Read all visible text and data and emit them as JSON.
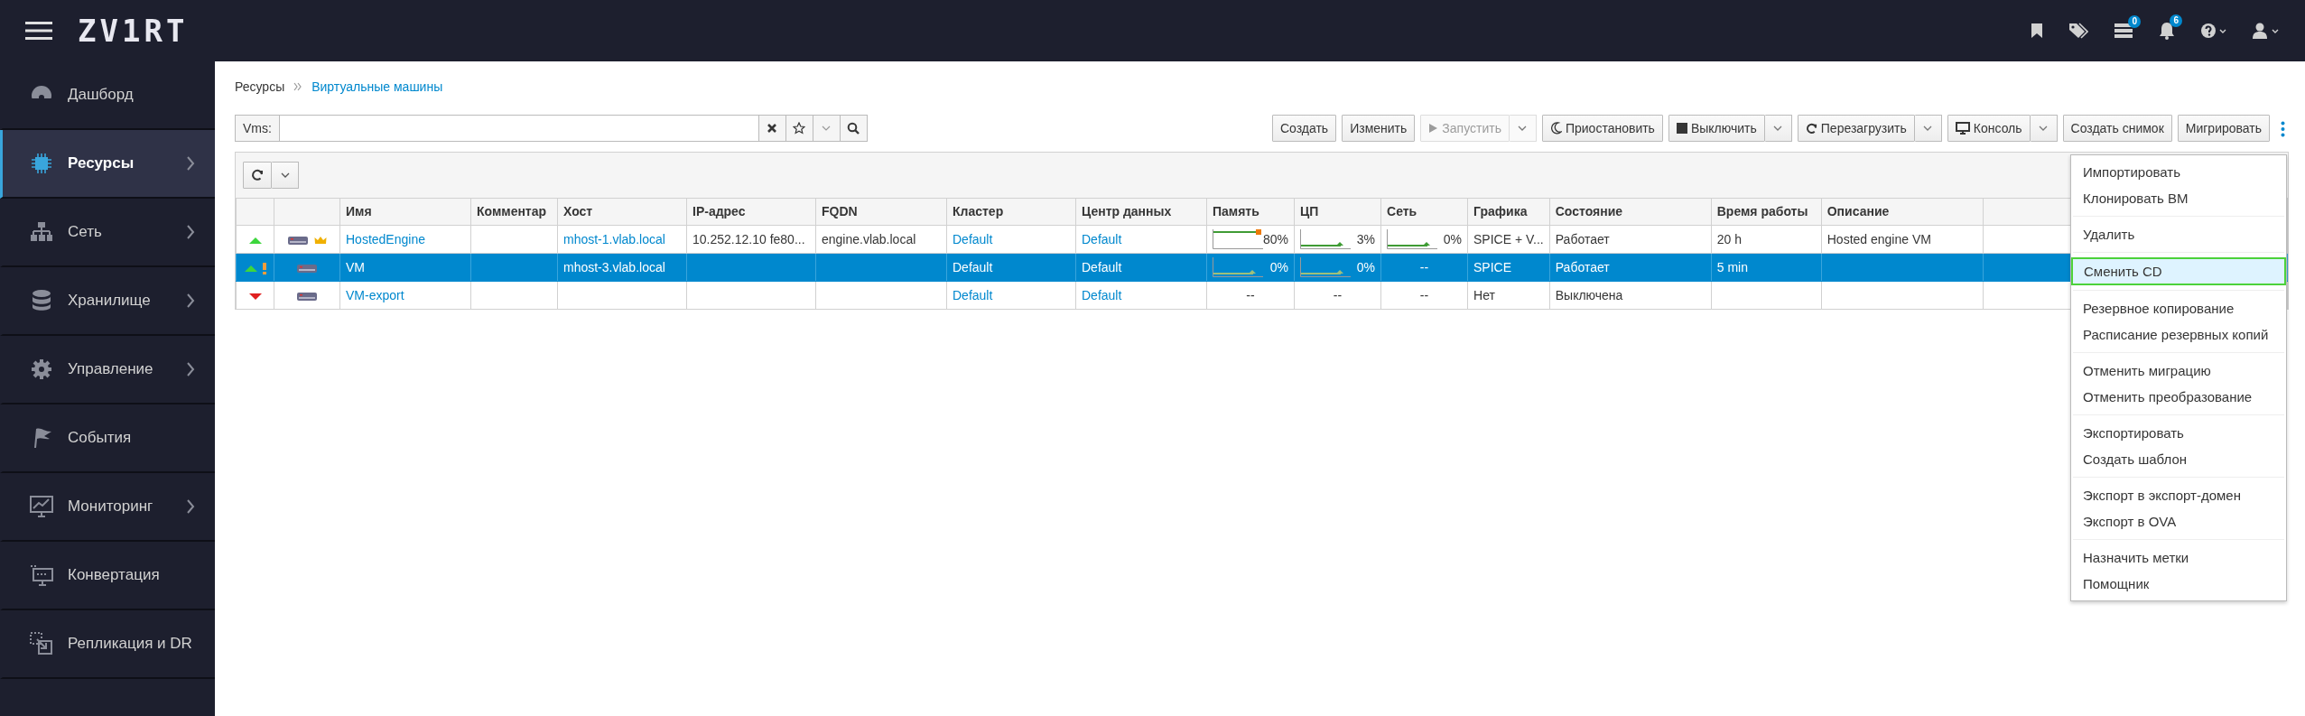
{
  "topbar": {
    "logo": "ZV1RT",
    "task_badge": "0",
    "alert_badge": "6"
  },
  "sidebar": {
    "items": [
      {
        "label": "Дашборд",
        "selected": false,
        "has_submenu": false
      },
      {
        "label": "Ресурсы",
        "selected": true,
        "has_submenu": true
      },
      {
        "label": "Сеть",
        "selected": false,
        "has_submenu": true
      },
      {
        "label": "Хранилище",
        "selected": false,
        "has_submenu": true
      },
      {
        "label": "Управление",
        "selected": false,
        "has_submenu": true
      },
      {
        "label": "События",
        "selected": false,
        "has_submenu": false
      },
      {
        "label": "Мониторинг",
        "selected": false,
        "has_submenu": true
      },
      {
        "label": "Конвертация",
        "selected": false,
        "has_submenu": false
      },
      {
        "label": "Репликация и DR",
        "selected": false,
        "has_submenu": false
      }
    ]
  },
  "breadcrumb": [
    {
      "label": "Ресурсы",
      "link": false
    },
    {
      "label": "Виртуальные машины",
      "link": true
    }
  ],
  "search": {
    "label": "Vms:"
  },
  "actions": [
    {
      "label": "Создать",
      "kind": "plain",
      "disabled": false
    },
    {
      "label": "Изменить",
      "kind": "plain",
      "disabled": false
    },
    {
      "label": "Запустить",
      "kind": "split",
      "disabled": true
    },
    {
      "label": "Приостановить",
      "kind": "plain",
      "disabled": false
    },
    {
      "label": "Выключить",
      "kind": "split",
      "disabled": false
    },
    {
      "label": "Перезагрузить",
      "kind": "split",
      "disabled": false
    },
    {
      "label": "Консоль",
      "kind": "split",
      "disabled": false
    },
    {
      "label": "Создать снимок",
      "kind": "plain",
      "disabled": false
    },
    {
      "label": "Мигрировать",
      "kind": "plain",
      "disabled": false
    }
  ],
  "table": {
    "columns": [
      {
        "kind": "status"
      },
      {
        "kind": "type"
      },
      {
        "label": "Имя",
        "kind": "text"
      },
      {
        "label": "Комментар",
        "kind": "text"
      },
      {
        "label": "Хост",
        "kind": "text"
      },
      {
        "label": "IP-адрес",
        "kind": "text"
      },
      {
        "label": "FQDN",
        "kind": "text"
      },
      {
        "label": "Кластер",
        "kind": "text"
      },
      {
        "label": "Центр данных",
        "kind": "text"
      },
      {
        "label": "Память",
        "kind": "usage"
      },
      {
        "label": "ЦП",
        "kind": "usage"
      },
      {
        "label": "Сеть",
        "kind": "usage"
      },
      {
        "label": "Графика",
        "kind": "text"
      },
      {
        "label": "Состояние",
        "kind": "text"
      },
      {
        "label": "Время работы",
        "kind": "text"
      },
      {
        "label": "Описание",
        "kind": "text"
      }
    ],
    "rows": [
      {
        "selected": false,
        "cells": [
          {
            "up": true,
            "alert": false
          },
          {
            "hosted_engine": true
          },
          {
            "text": "HostedEngine",
            "link": true
          },
          {},
          {
            "text": "mhost-1.vlab.local",
            "link": true
          },
          {
            "text": "10.252.12.10 fe80...",
            "link": false
          },
          {
            "text": "engine.vlab.local",
            "link": false
          },
          {
            "text": "Default",
            "link": true
          },
          {
            "text": "Default",
            "link": true
          },
          {
            "reading": "80%",
            "graph": true,
            "peak": true
          },
          {
            "reading": "3%",
            "graph": true,
            "peak": false
          },
          {
            "reading": "0%",
            "graph": true,
            "peak": false
          },
          {
            "text": "SPICE + V...",
            "link": false
          },
          {
            "text": "Работает",
            "link": false
          },
          {
            "text": "20 h",
            "link": false
          },
          {
            "text": "Hosted engine VM",
            "link": false
          }
        ]
      },
      {
        "selected": true,
        "cells": [
          {
            "up": true,
            "alert": true
          },
          {
            "hosted_engine": false
          },
          {
            "text": "VM"
          },
          {},
          {
            "text": "mhost-3.vlab.local"
          },
          {},
          {},
          {
            "text": "Default"
          },
          {
            "text": "Default"
          },
          {
            "reading": "0%",
            "graph": true,
            "peak": false
          },
          {
            "reading": "0%",
            "graph": true,
            "peak": false
          },
          {
            "reading": "--",
            "graph": false
          },
          {
            "text": "SPICE"
          },
          {
            "text": "Работает"
          },
          {
            "text": "5 min"
          },
          {}
        ]
      },
      {
        "selected": false,
        "cells": [
          {
            "up": false,
            "alert": false
          },
          {
            "hosted_engine": false
          },
          {
            "text": "VM-export",
            "link": true
          },
          {},
          {},
          {},
          {},
          {
            "text": "Default",
            "link": true
          },
          {
            "text": "Default",
            "link": true
          },
          {
            "reading": "--",
            "graph": false
          },
          {
            "reading": "--",
            "graph": false
          },
          {
            "reading": "--",
            "graph": false
          },
          {
            "text": "Нет",
            "link": false
          },
          {
            "text": "Выключена",
            "link": false
          },
          {},
          {}
        ]
      }
    ]
  },
  "menu": {
    "groups": [
      [
        {
          "label": "Импортировать",
          "selected": false
        },
        {
          "label": "Клонировать ВМ",
          "selected": false
        }
      ],
      [
        {
          "label": "Удалить",
          "selected": false
        }
      ],
      [
        {
          "label": "Сменить CD",
          "selected": true
        }
      ],
      [
        {
          "label": "Резервное копирование",
          "selected": false
        },
        {
          "label": "Расписание резервных копий",
          "selected": false
        }
      ],
      [
        {
          "label": "Отменить миграцию",
          "selected": false
        },
        {
          "label": "Отменить преобразование",
          "selected": false
        }
      ],
      [
        {
          "label": "Экспортировать",
          "selected": false
        },
        {
          "label": "Создать шаблон",
          "selected": false
        }
      ],
      [
        {
          "label": "Экспорт в экспорт-домен",
          "selected": false
        },
        {
          "label": "Экспорт в OVA",
          "selected": false
        }
      ],
      [
        {
          "label": "Назначить метки",
          "selected": false
        },
        {
          "label": "Помощник",
          "selected": false
        }
      ]
    ]
  }
}
